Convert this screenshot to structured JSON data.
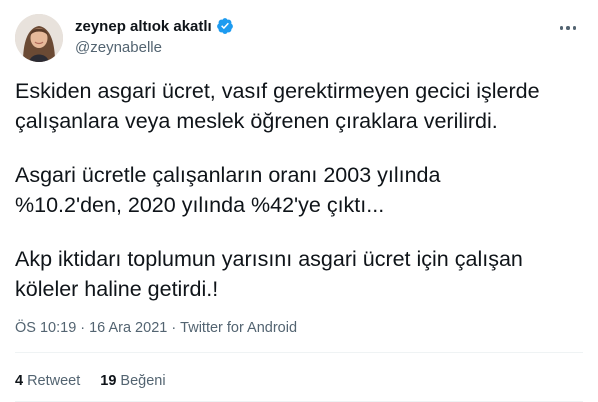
{
  "author": {
    "display_name": "zeynep altıok akatlı",
    "handle": "@zeynabelle",
    "verified": true
  },
  "tweet": {
    "paragraphs": [
      "Eskiden asgari ücret, vasıf gerektirmeyen gecici işlerde\nçalışanlara veya meslek öğrenen çıraklara verilirdi.",
      "Asgari ücretle çalışanların oranı 2003 yılında\n%10.2'den, 2020 yılında %42'ye çıktı...",
      "Akp iktidarı toplumun yarısını asgari ücret için çalışan\nköleler haline getirdi.!"
    ]
  },
  "meta": {
    "time": "ÖS 10:19",
    "date": "16 Ara 2021",
    "source": "Twitter for Android",
    "separator": "·"
  },
  "stats": {
    "retweets_count": "4",
    "retweets_label": "Retweet",
    "likes_count": "19",
    "likes_label": "Beğeni"
  },
  "colors": {
    "verified_badge": "#1d9bf0",
    "text_primary": "#0f1419",
    "text_secondary": "#536471"
  }
}
